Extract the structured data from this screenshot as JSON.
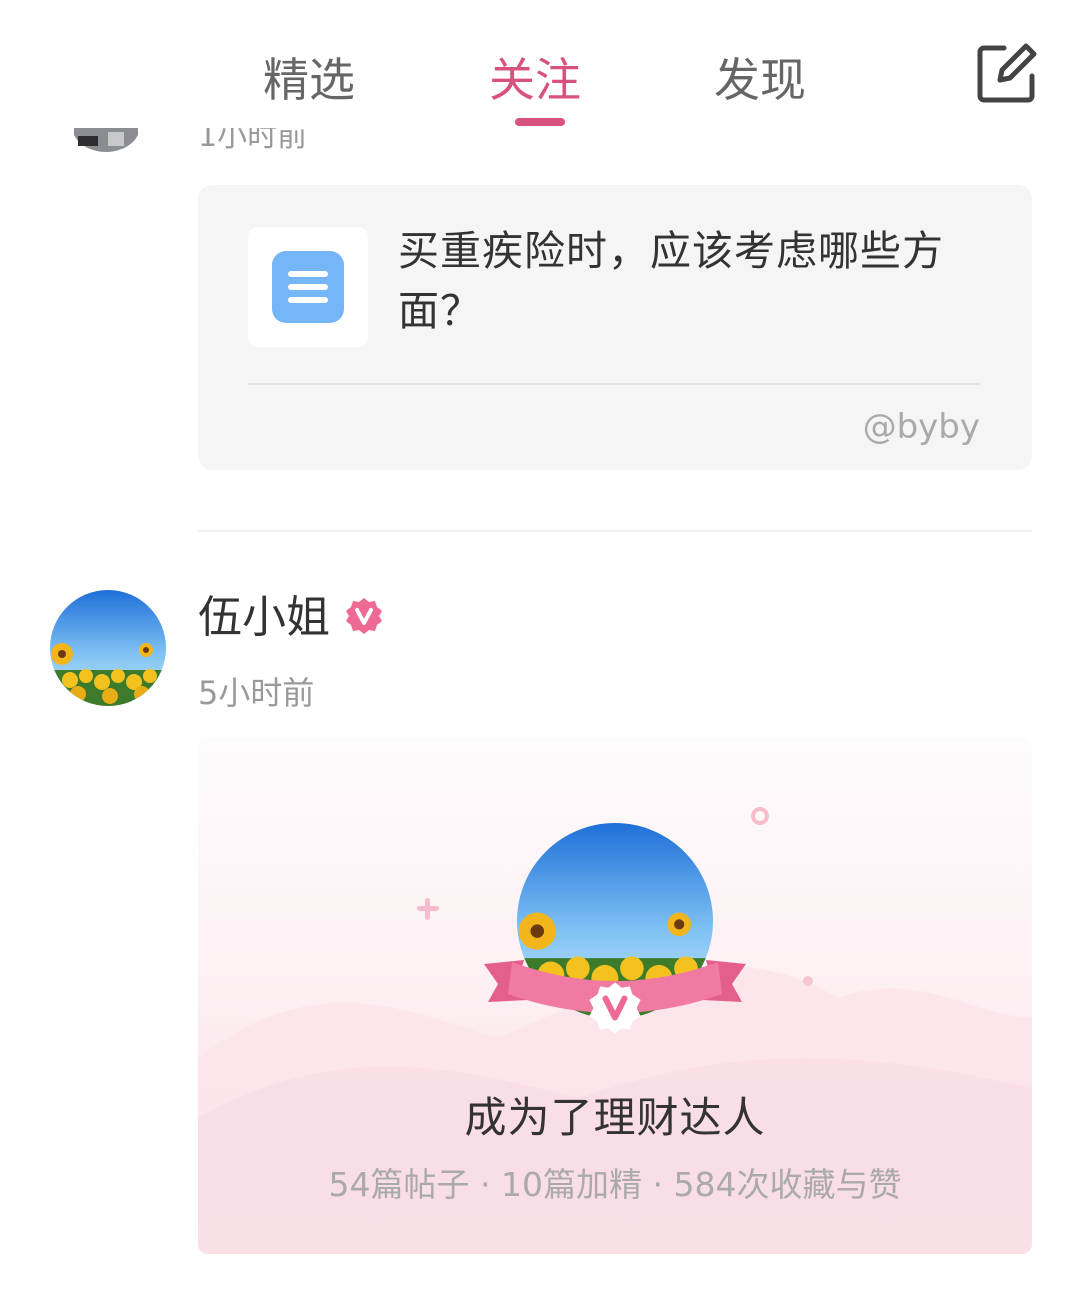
{
  "tabs": [
    {
      "label": "精选",
      "active": false
    },
    {
      "label": "关注",
      "active": true
    },
    {
      "label": "发现",
      "active": false
    }
  ],
  "header": {
    "edit_icon": "compose-icon"
  },
  "previous_post": {
    "time_partial": "1小时前"
  },
  "question_card": {
    "icon": "document-icon",
    "text": "买重疾险时，应该考虑哪些方面？",
    "author": "@byby"
  },
  "post": {
    "user_name": "伍小姐",
    "verified_icon": "verified-v-badge",
    "time": "5小时前",
    "card": {
      "badge_letter": "V",
      "title": "成为了理财达人",
      "stats": "54篇帖子 · 10篇加精 · 584次收藏与赞"
    }
  },
  "colors": {
    "accent": "#d8527f",
    "badge": "#ee6a94",
    "ribbon": "#f07aa2",
    "doc_icon": "#74b6f8"
  }
}
